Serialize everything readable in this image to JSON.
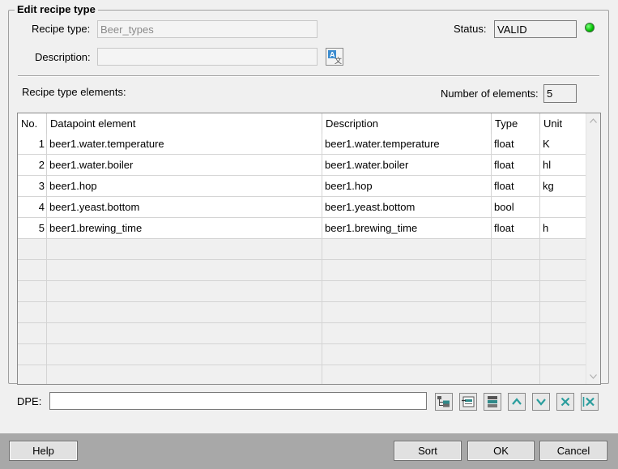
{
  "dialog": {
    "title": "Edit recipe type"
  },
  "form": {
    "recipe_type_label": "Recipe type:",
    "recipe_type_value": "Beer_types",
    "status_label": "Status:",
    "status_value": "VALID",
    "status_led_color": "#00c000",
    "description_label": "Description:",
    "description_value": "",
    "elements_label": "Recipe type elements:",
    "num_elements_label": "Number of elements:",
    "num_elements_value": "5"
  },
  "table": {
    "columns": [
      "No.",
      "Datapoint element",
      "Description",
      "Type",
      "Unit"
    ],
    "rows": [
      [
        "1",
        "beer1.water.temperature",
        "beer1.water.temperature",
        "float",
        "K"
      ],
      [
        "2",
        "beer1.water.boiler",
        "beer1.water.boiler",
        "float",
        "hl"
      ],
      [
        "3",
        "beer1.hop",
        "beer1.hop",
        "float",
        "kg"
      ],
      [
        "4",
        "beer1.yeast.bottom",
        "beer1.yeast.bottom",
        "bool",
        ""
      ],
      [
        "5",
        "beer1.brewing_time",
        "beer1.brewing_time",
        "float",
        "h"
      ],
      [
        "",
        "",
        "",
        "",
        ""
      ],
      [
        "",
        "",
        "",
        "",
        ""
      ],
      [
        "",
        "",
        "",
        "",
        ""
      ],
      [
        "",
        "",
        "",
        "",
        ""
      ],
      [
        "",
        "",
        "",
        "",
        ""
      ],
      [
        "",
        "",
        "",
        "",
        ""
      ],
      [
        "",
        "",
        "",
        "",
        ""
      ]
    ]
  },
  "dpe": {
    "label": "DPE:",
    "value": ""
  },
  "toolbar_icons": [
    "tree-select-icon",
    "list-select-icon",
    "insert-row-icon",
    "move-up-icon",
    "move-down-icon",
    "delete-icon",
    "delete-all-icon"
  ],
  "buttons": {
    "help": "Help",
    "sort": "Sort",
    "ok": "OK",
    "cancel": "Cancel"
  }
}
